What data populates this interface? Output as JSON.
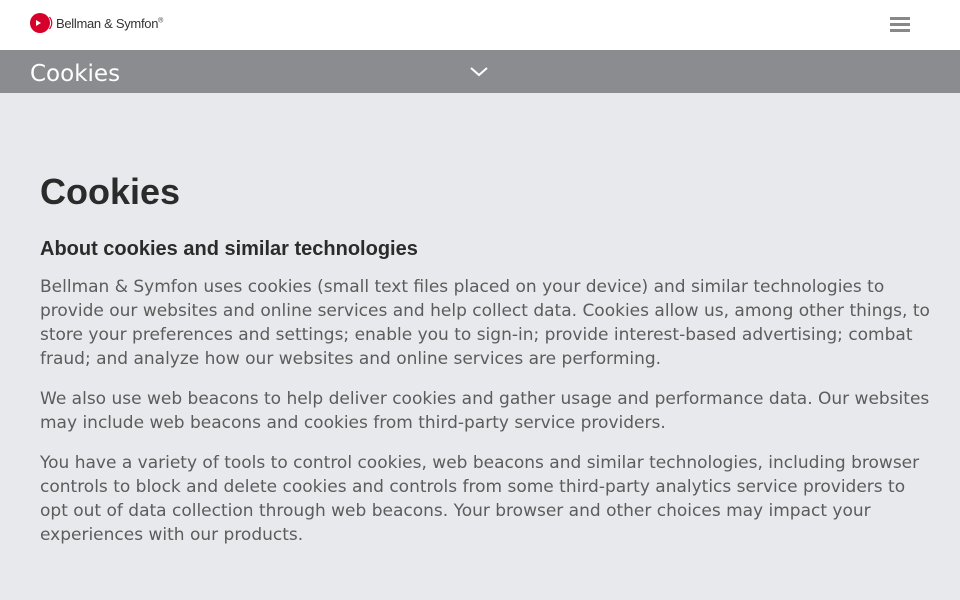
{
  "header": {
    "brand_name": "Bellman & Symfon",
    "brand_mark": "®",
    "logo_color": "#d6002a",
    "menu_icon": "hamburger-menu-icon"
  },
  "subnav": {
    "title": "Cookies",
    "chevron_icon": "chevron-down-icon"
  },
  "main": {
    "title": "Cookies",
    "section_heading": "About cookies and similar technologies",
    "paragraphs": [
      "Bellman & Symfon uses cookies (small text files placed on your device) and similar technologies to provide our websites and online services and help collect data. Cookies allow us, among other things, to store your preferences and settings; enable you to sign-in; provide interest-based advertising; combat fraud; and analyze how our websites and online services are performing.",
      "We also use web beacons to help deliver cookies and gather usage and performance data. Our websites may include web beacons and cookies from third-party service providers.",
      "You have a variety of tools to control cookies, web beacons and similar technologies, including browser controls to block and delete cookies and controls from some third-party analytics service providers to opt out of data collection through web beacons. Your browser and other choices may impact your experiences with our products."
    ]
  }
}
